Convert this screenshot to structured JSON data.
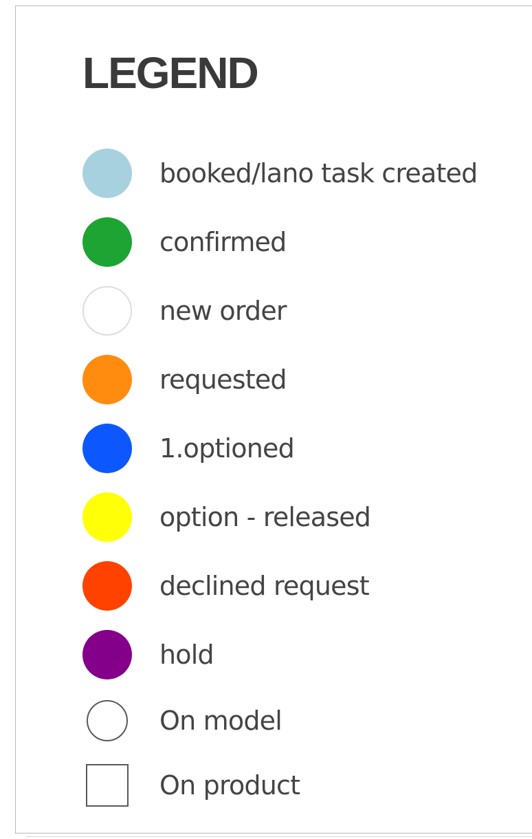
{
  "legend": {
    "title": "LEGEND",
    "items": [
      {
        "label": "booked/lano task created",
        "color": "#a8d1e0",
        "shape": "circle"
      },
      {
        "label": "confirmed",
        "color": "#1ea432",
        "shape": "circle"
      },
      {
        "label": "new order",
        "color": "#ffffff",
        "shape": "circle",
        "border": "#dedede"
      },
      {
        "label": "requested",
        "color": "#ff8c0f",
        "shape": "circle"
      },
      {
        "label": "1.optioned",
        "color": "#0d57ff",
        "shape": "circle"
      },
      {
        "label": "option - released",
        "color": "#ffff08",
        "shape": "circle"
      },
      {
        "label": "declined request",
        "color": "#ff4200",
        "shape": "circle"
      },
      {
        "label": "hold",
        "color": "#84008a",
        "shape": "circle"
      },
      {
        "label": "On model",
        "color": "#ffffff",
        "shape": "outline-circle"
      },
      {
        "label": "On product",
        "color": "#ffffff",
        "shape": "outline-square"
      }
    ]
  }
}
